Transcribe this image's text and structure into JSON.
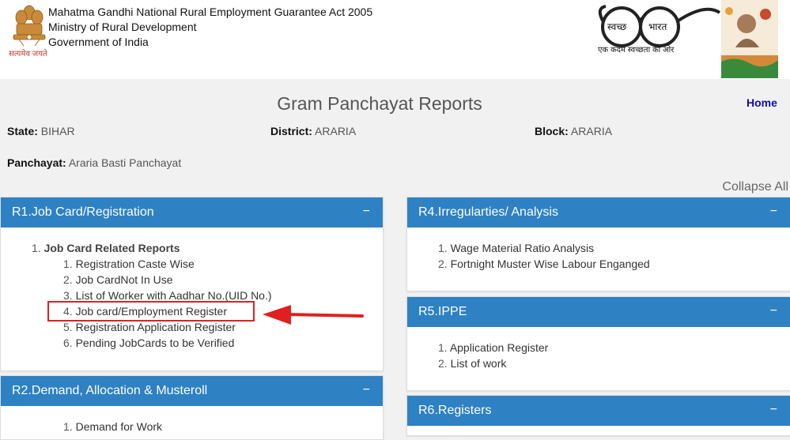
{
  "header": {
    "org_lines": [
      "Mahatma Gandhi National Rural Employment Guarantee Act 2005",
      "Ministry of Rural Development",
      "Government of India"
    ],
    "emblem_motto": "सत्यमेव जयते",
    "swachh_left": "स्वच्छ",
    "swachh_right": "भारत",
    "swachh_tagline": "एक कदम स्वच्छता की ओर",
    "icons": [
      "national-emblem-icon",
      "swachh-bharat-glasses-icon",
      "gandhi-logo-icon"
    ]
  },
  "page": {
    "title": "Gram Panchayat Reports",
    "home_label": "Home",
    "collapse_all_label": "Collapse All"
  },
  "location": {
    "state_label": "State:",
    "state_value": "BIHAR",
    "district_label": "District:",
    "district_value": "ARARIA",
    "block_label": "Block:",
    "block_value": "ARARIA",
    "panchayat_label": "Panchayat:",
    "panchayat_value": "Araria Basti Panchayat"
  },
  "panels": {
    "r1": {
      "title": "R1.Job Card/Registration",
      "toggle": "−",
      "group_num": "1.",
      "group_label": "Job Card Related Reports",
      "items": [
        {
          "n": "1.",
          "label": "Registration Caste Wise"
        },
        {
          "n": "2.",
          "label": "Job CardNot In Use"
        },
        {
          "n": "3.",
          "label": "List of Worker with Aadhar No.(UID No.)"
        },
        {
          "n": "4.",
          "label": "Job card/Employment Register"
        },
        {
          "n": "5.",
          "label": "Registration Application Register"
        },
        {
          "n": "6.",
          "label": "Pending JobCards to be Verified"
        }
      ]
    },
    "r2": {
      "title": "R2.Demand, Allocation & Musteroll",
      "toggle": "−",
      "items": [
        {
          "n": "1.",
          "label": "Demand for Work"
        }
      ]
    },
    "r4": {
      "title": "R4.Irregularties/ Analysis",
      "toggle": "−",
      "items": [
        {
          "n": "1.",
          "label": "Wage Material Ratio Analysis"
        },
        {
          "n": "2.",
          "label": "Fortnight Muster Wise Labour Enganged"
        }
      ]
    },
    "r5": {
      "title": "R5.IPPE",
      "toggle": "−",
      "items": [
        {
          "n": "1.",
          "label": "Application Register"
        },
        {
          "n": "2.",
          "label": "List of work"
        }
      ]
    },
    "r6": {
      "title": "R6.Registers",
      "toggle": "−"
    }
  },
  "colors": {
    "panel_header": "#2e81c3",
    "annotation": "#e02020",
    "home_link": "#1010a0"
  }
}
